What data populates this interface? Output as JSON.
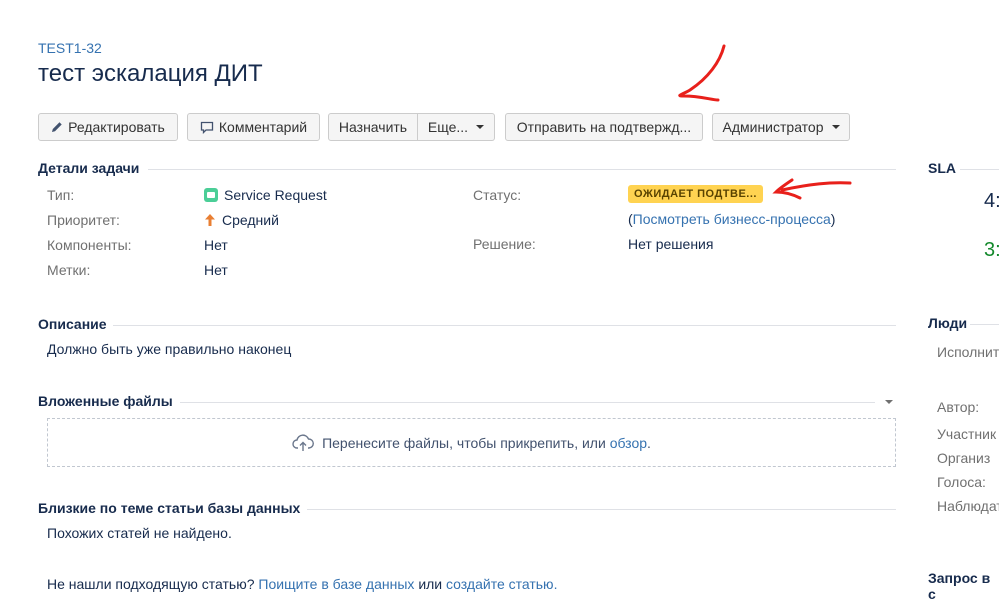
{
  "issue": {
    "key": "TEST1-32",
    "title": "тест эскалация ДИТ"
  },
  "toolbar": {
    "edit": "Редактировать",
    "comment": "Комментарий",
    "assign": "Назначить",
    "more": "Еще...",
    "send_for_approval": "Отправить на подтвержд...",
    "admin": "Администратор"
  },
  "details": {
    "heading": "Детали задачи",
    "type_label": "Тип:",
    "type_value": "Service Request",
    "priority_label": "Приоритет:",
    "priority_value": "Средний",
    "components_label": "Компоненты:",
    "components_value": "Нет",
    "labels_label": "Метки:",
    "labels_value": "Нет",
    "status_label": "Статус:",
    "status_value": "ОЖИДАЕТ ПОДТВЕ...",
    "workflow_open": "(",
    "workflow_link": "Посмотреть бизнесс-процесса",
    "workflow_close": ")",
    "resolution_label": "Решение:",
    "resolution_value": "Нет решения"
  },
  "description": {
    "heading": "Описание",
    "text": "Должно быть уже правильно наконец"
  },
  "attachments": {
    "heading": "Вложенные файлы",
    "drop_text": "Перенесите файлы, чтобы прикрепить, или",
    "browse_link": "обзор",
    "period": "."
  },
  "kb": {
    "heading": "Близкие по теме статьи базы данных",
    "none_text": "Похожих статей не найдено.",
    "not_found_text": "Не нашли подходящую статью?",
    "search_link": "Поищите в базе данных",
    "or_text": "или",
    "create_link": "создайте статью",
    "period": "."
  },
  "sidebar": {
    "sla_heading": "SLA",
    "sla_value_1": "4:",
    "sla_value_2": "3:",
    "people_heading": "Люди",
    "assignee_label": "Исполнит",
    "author_label": "Автор:",
    "participants_label": "Участник",
    "organization_label": "Организ",
    "votes_label": "Голоса:",
    "watchers_label": "Наблюдат",
    "request_heading": "Запрос в с"
  },
  "colors": {
    "link": "#3572b0",
    "status_bg": "#ffd351",
    "type_icon": "#4bce97",
    "priority_arrow": "#e97f33",
    "sla_green": "#14892c",
    "annotation_red": "#e8201b"
  }
}
